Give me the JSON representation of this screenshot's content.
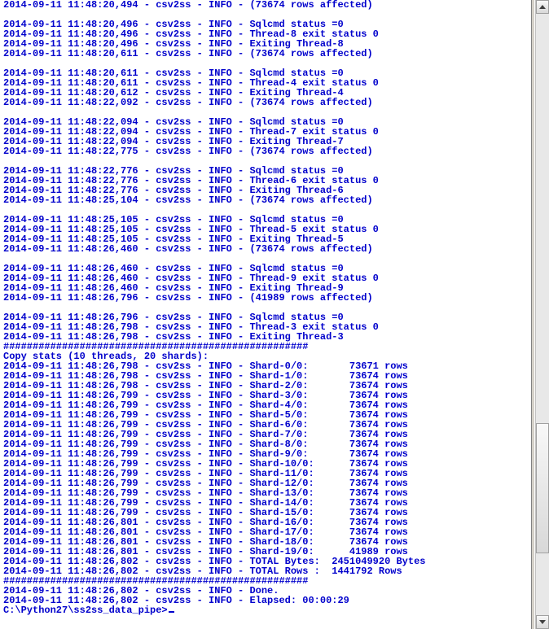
{
  "lines": [
    "2014-09-11 11:48:20,494 - csv2ss - INFO - (73674 rows affected)",
    "",
    "2014-09-11 11:48:20,496 - csv2ss - INFO - Sqlcmd status =0",
    "2014-09-11 11:48:20,496 - csv2ss - INFO - Thread-8 exit status 0",
    "2014-09-11 11:48:20,496 - csv2ss - INFO - Exiting Thread-8",
    "2014-09-11 11:48:20,611 - csv2ss - INFO - (73674 rows affected)",
    "",
    "2014-09-11 11:48:20,611 - csv2ss - INFO - Sqlcmd status =0",
    "2014-09-11 11:48:20,611 - csv2ss - INFO - Thread-4 exit status 0",
    "2014-09-11 11:48:20,612 - csv2ss - INFO - Exiting Thread-4",
    "2014-09-11 11:48:22,092 - csv2ss - INFO - (73674 rows affected)",
    "",
    "2014-09-11 11:48:22,094 - csv2ss - INFO - Sqlcmd status =0",
    "2014-09-11 11:48:22,094 - csv2ss - INFO - Thread-7 exit status 0",
    "2014-09-11 11:48:22,094 - csv2ss - INFO - Exiting Thread-7",
    "2014-09-11 11:48:22,775 - csv2ss - INFO - (73674 rows affected)",
    "",
    "2014-09-11 11:48:22,776 - csv2ss - INFO - Sqlcmd status =0",
    "2014-09-11 11:48:22,776 - csv2ss - INFO - Thread-6 exit status 0",
    "2014-09-11 11:48:22,776 - csv2ss - INFO - Exiting Thread-6",
    "2014-09-11 11:48:25,104 - csv2ss - INFO - (73674 rows affected)",
    "",
    "2014-09-11 11:48:25,105 - csv2ss - INFO - Sqlcmd status =0",
    "2014-09-11 11:48:25,105 - csv2ss - INFO - Thread-5 exit status 0",
    "2014-09-11 11:48:25,105 - csv2ss - INFO - Exiting Thread-5",
    "2014-09-11 11:48:26,460 - csv2ss - INFO - (73674 rows affected)",
    "",
    "2014-09-11 11:48:26,460 - csv2ss - INFO - Sqlcmd status =0",
    "2014-09-11 11:48:26,460 - csv2ss - INFO - Thread-9 exit status 0",
    "2014-09-11 11:48:26,460 - csv2ss - INFO - Exiting Thread-9",
    "2014-09-11 11:48:26,796 - csv2ss - INFO - (41989 rows affected)",
    "",
    "2014-09-11 11:48:26,796 - csv2ss - INFO - Sqlcmd status =0",
    "2014-09-11 11:48:26,798 - csv2ss - INFO - Thread-3 exit status 0",
    "2014-09-11 11:48:26,798 - csv2ss - INFO - Exiting Thread-3",
    "####################################################",
    "Copy stats (10 threads, 20 shards):",
    "2014-09-11 11:48:26,798 - csv2ss - INFO - Shard-0/0:       73671 rows",
    "2014-09-11 11:48:26,798 - csv2ss - INFO - Shard-1/0:       73674 rows",
    "2014-09-11 11:48:26,798 - csv2ss - INFO - Shard-2/0:       73674 rows",
    "2014-09-11 11:48:26,799 - csv2ss - INFO - Shard-3/0:       73674 rows",
    "2014-09-11 11:48:26,799 - csv2ss - INFO - Shard-4/0:       73674 rows",
    "2014-09-11 11:48:26,799 - csv2ss - INFO - Shard-5/0:       73674 rows",
    "2014-09-11 11:48:26,799 - csv2ss - INFO - Shard-6/0:       73674 rows",
    "2014-09-11 11:48:26,799 - csv2ss - INFO - Shard-7/0:       73674 rows",
    "2014-09-11 11:48:26,799 - csv2ss - INFO - Shard-8/0:       73674 rows",
    "2014-09-11 11:48:26,799 - csv2ss - INFO - Shard-9/0:       73674 rows",
    "2014-09-11 11:48:26,799 - csv2ss - INFO - Shard-10/0:      73674 rows",
    "2014-09-11 11:48:26,799 - csv2ss - INFO - Shard-11/0:      73674 rows",
    "2014-09-11 11:48:26,799 - csv2ss - INFO - Shard-12/0:      73674 rows",
    "2014-09-11 11:48:26,799 - csv2ss - INFO - Shard-13/0:      73674 rows",
    "2014-09-11 11:48:26,799 - csv2ss - INFO - Shard-14/0:      73674 rows",
    "2014-09-11 11:48:26,799 - csv2ss - INFO - Shard-15/0:      73674 rows",
    "2014-09-11 11:48:26,801 - csv2ss - INFO - Shard-16/0:      73674 rows",
    "2014-09-11 11:48:26,801 - csv2ss - INFO - Shard-17/0:      73674 rows",
    "2014-09-11 11:48:26,801 - csv2ss - INFO - Shard-18/0:      73674 rows",
    "2014-09-11 11:48:26,801 - csv2ss - INFO - Shard-19/0:      41989 rows",
    "2014-09-11 11:48:26,802 - csv2ss - INFO - TOTAL Bytes:  2451049920 Bytes",
    "2014-09-11 11:48:26,802 - csv2ss - INFO - TOTAL Rows :  1441792 Rows",
    "####################################################",
    "2014-09-11 11:48:26,802 - csv2ss - INFO - Done.",
    "2014-09-11 11:48:26,802 - csv2ss - INFO - Elapsed: 00:00:29",
    ""
  ],
  "prompt": "C:\\Python27\\ss2ss_data_pipe>"
}
